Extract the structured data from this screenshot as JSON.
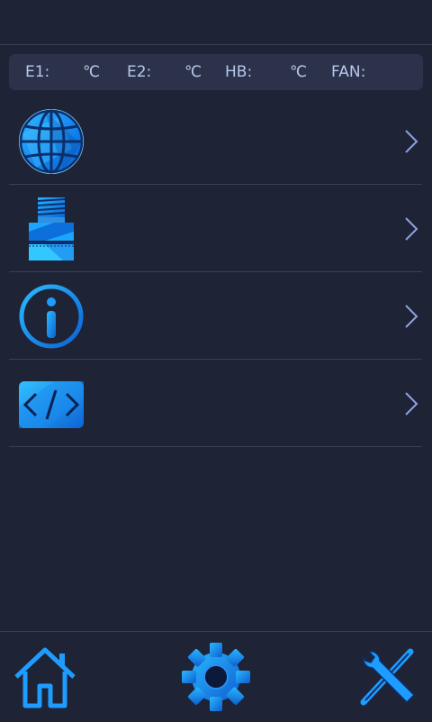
{
  "status": {
    "e1_label": "E1:",
    "e1_unit": "℃",
    "e2_label": "E2:",
    "e2_unit": "℃",
    "hb_label": "HB:",
    "hb_unit": "℃",
    "fan_label": "FAN:"
  },
  "menu": {
    "items": [
      {
        "icon": "globe-icon"
      },
      {
        "icon": "filament-spool-icon"
      },
      {
        "icon": "info-icon"
      },
      {
        "icon": "code-icon"
      }
    ]
  },
  "bottom_nav": {
    "home": {
      "icon": "home-icon"
    },
    "settings": {
      "icon": "gear-icon"
    },
    "tools": {
      "icon": "tools-icon"
    }
  },
  "colors": {
    "background": "#1e2336",
    "panel": "#2b324a",
    "accent": "#1ea4ff",
    "accent_dark": "#0f6fd8",
    "divider": "#3a4157",
    "text": "#b9c7ea"
  }
}
